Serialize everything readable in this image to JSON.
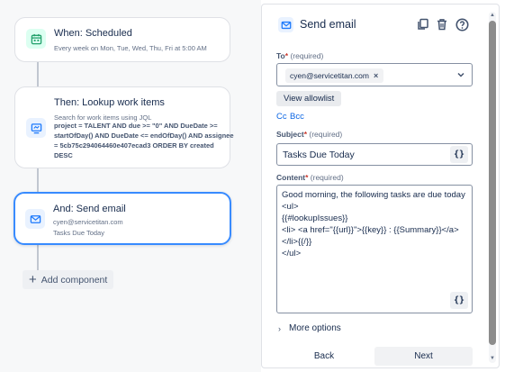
{
  "flow": {
    "trigger": {
      "title": "When: Scheduled",
      "subtitle": "Every week on Mon, Tue, Wed, Thu, Fri at 5:00 AM",
      "icon": "calendar-icon"
    },
    "lookup": {
      "title": "Then: Lookup work items",
      "subtitle": "Search for work items using JQL",
      "jql": "project = TALENT AND due >= \"0\" AND DueDate >= startOfDay() AND DueDate <= endOfDay() AND assignee = 5cb75c294064460e407ecad3 ORDER BY created DESC",
      "icon": "monitor-icon"
    },
    "email": {
      "title": "And: Send email",
      "to": "cyen@servicetitan.com",
      "subject": "Tasks Due Today",
      "icon": "envelope-icon"
    },
    "add_component_label": "Add component"
  },
  "panel": {
    "title": "Send email",
    "icons": [
      "copy-icon",
      "trash-icon",
      "help-icon"
    ],
    "to_label": "To",
    "to_required": "(required)",
    "to_tag": "cyen@servicetitan.com",
    "to_tag_remove": "×",
    "view_allowlist": "View allowlist",
    "cc": "Cc",
    "bcc": "Bcc",
    "subject_label": "Subject",
    "subject_required": "(required)",
    "subject_value": "Tasks Due Today",
    "brace_label": "{}",
    "content_label": "Content",
    "content_required": "(required)",
    "content_lines": [
      "Good morning, the following tasks are due today",
      "<ul>",
      "{{#lookupIssues}}",
      "<li> <a href=\"{{url}}\">{{key}} : {{Summary}}</a>",
      "</li>{{/}}",
      "</ul>"
    ],
    "more_options": "More options",
    "back": "Back",
    "next": "Next"
  },
  "colors": {
    "accent": "#388bff",
    "link": "#0c66e4",
    "required": "#c9372c",
    "trigger_icon_bg": "#dcfff1",
    "action_icon_bg": "#e9f2ff"
  }
}
